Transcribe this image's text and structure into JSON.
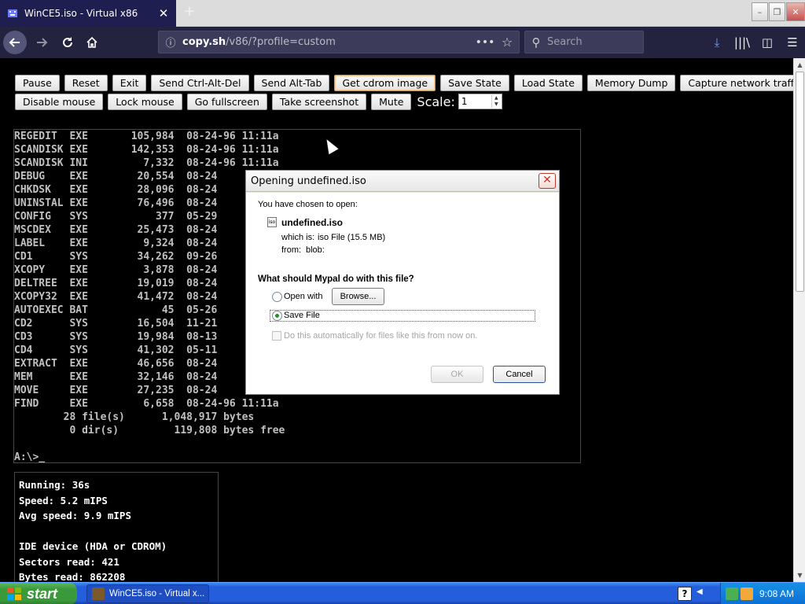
{
  "browser": {
    "tab_title": "WinCE5.iso - Virtual x86",
    "url_host": "copy.sh",
    "url_path": "/v86/?profile=custom",
    "search_placeholder": "Search"
  },
  "toolbar": {
    "row1": [
      "Pause",
      "Reset",
      "Exit",
      "Send Ctrl-Alt-Del",
      "Send Alt-Tab",
      "Get cdrom image",
      "Save State",
      "Load State",
      "Memory Dump",
      "Capture network traffic"
    ],
    "row2": [
      "Disable mouse",
      "Lock mouse",
      "Go fullscreen",
      "Take screenshot",
      "Mute"
    ],
    "scale_label": "Scale:",
    "scale_value": "1"
  },
  "dos_screen": {
    "lines": [
      "REGEDIT  EXE       105,984  08-24-96 11:11a",
      "SCANDISK EXE       142,353  08-24-96 11:11a",
      "SCANDISK INI         7,332  08-24-96 11:11a",
      "DEBUG    EXE        20,554  08-24",
      "CHKDSK   EXE        28,096  08-24",
      "UNINSTAL EXE        76,496  08-24",
      "CONFIG   SYS           377  05-29",
      "MSCDEX   EXE        25,473  08-24",
      "LABEL    EXE         9,324  08-24",
      "CD1      SYS        34,262  09-26",
      "XCOPY    EXE         3,878  08-24",
      "DELTREE  EXE        19,019  08-24",
      "XCOPY32  EXE        41,472  08-24",
      "AUTOEXEC BAT            45  05-26",
      "CD2      SYS        16,504  11-21",
      "CD3      SYS        19,984  08-13",
      "CD4      SYS        41,302  05-11",
      "EXTRACT  EXE        46,656  08-24",
      "MEM      EXE        32,146  08-24",
      "MOVE     EXE        27,235  08-24",
      "FIND     EXE         6,658  08-24-96 11:11a",
      "        28 file(s)      1,048,917 bytes",
      "         0 dir(s)         119,808 bytes free",
      "",
      "A:\\>_"
    ]
  },
  "stats": {
    "lines": [
      "Running: 36s",
      "Speed: 5.2 mIPS",
      "Avg speed: 9.9 mIPS",
      "",
      "IDE device (HDA or CDROM)",
      "Sectors read: 421",
      "Bytes read: 862208"
    ]
  },
  "dialog": {
    "title": "Opening undefined.iso",
    "intro": "You have chosen to open:",
    "filename": "undefined.iso",
    "which_is_label": "which is:",
    "which_is_value": "iso File (15.5 MB)",
    "from_label": "from:",
    "from_value": "blob:",
    "question": "What should Mypal do with this file?",
    "open_with_label": "Open with",
    "browse_label": "Browse...",
    "save_file_label": "Save File",
    "auto_label": "Do this automatically for files like this from now on.",
    "ok_label": "OK",
    "cancel_label": "Cancel"
  },
  "taskbar": {
    "start_label": "start",
    "task_label": "WinCE5.iso - Virtual x...",
    "clock": "9:08 AM",
    "help_label": "?"
  }
}
